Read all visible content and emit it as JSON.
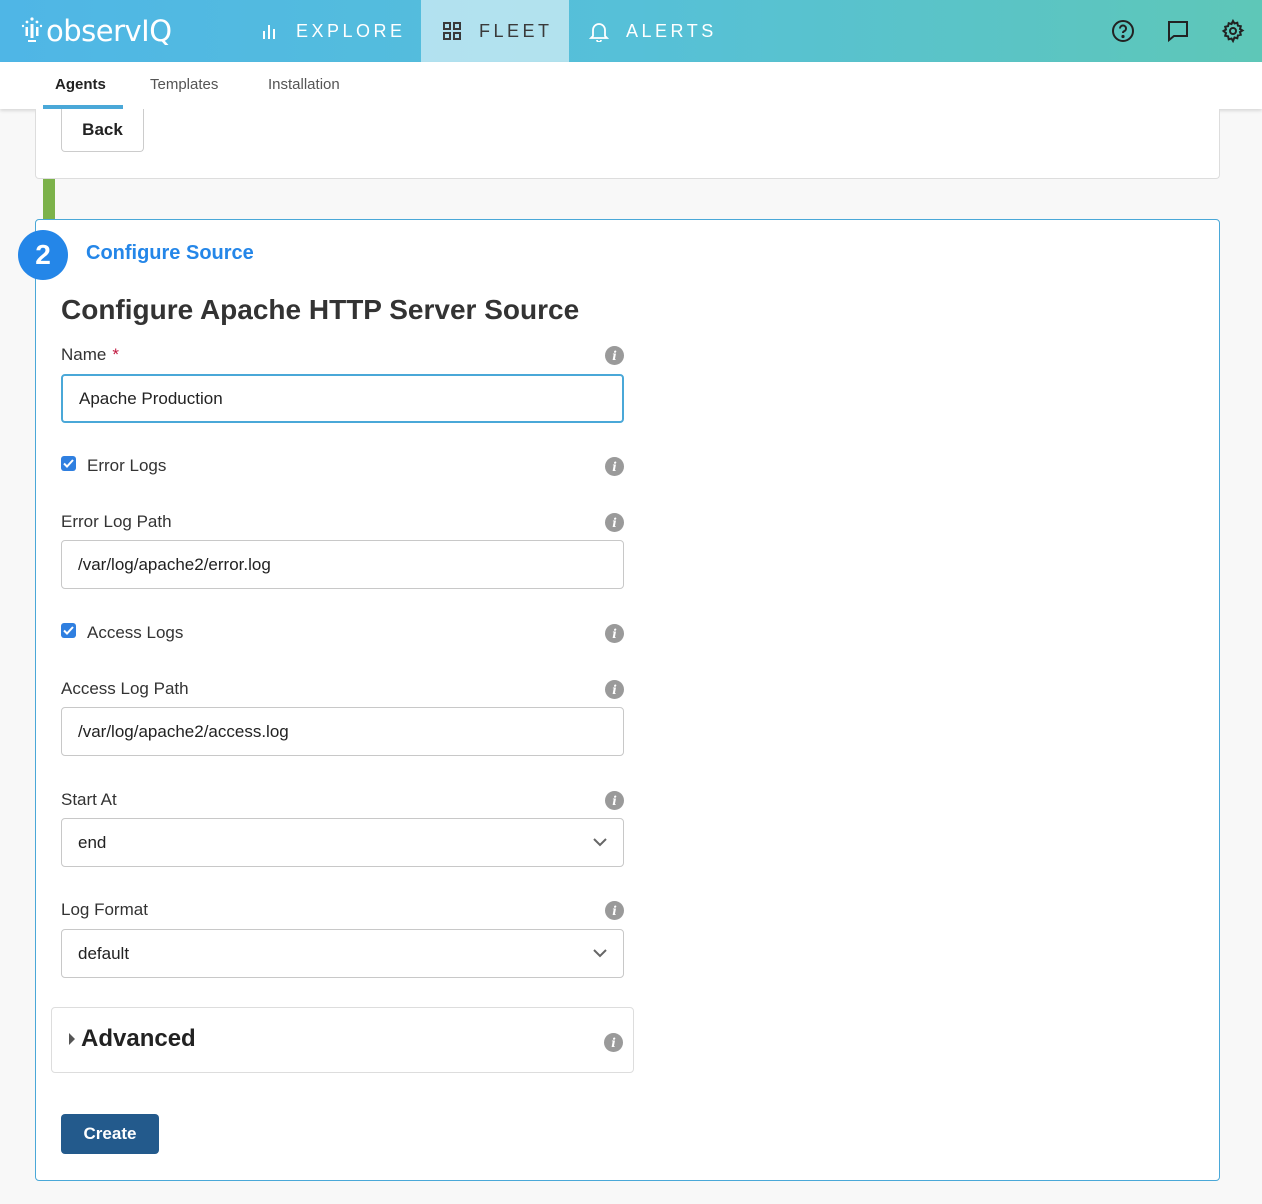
{
  "app": {
    "logo_text": "observIQ"
  },
  "nav": {
    "explore": "EXPLORE",
    "fleet": "FLEET",
    "alerts": "ALERTS"
  },
  "toolbar": {
    "help_icon": "help-circle-icon",
    "feedback_icon": "chat-icon",
    "settings_icon": "gear-icon"
  },
  "subnav": {
    "tabs": [
      "Agents",
      "Templates",
      "Installation"
    ],
    "active": "Agents"
  },
  "back_label": "Back",
  "step": {
    "number": "2",
    "label": "Configure Source"
  },
  "form": {
    "title": "Configure Apache HTTP Server Source",
    "name": {
      "label": "Name",
      "required_mark": "*",
      "value": "Apache Production"
    },
    "error_logs": {
      "label": "Error Logs",
      "checked": true
    },
    "error_log_path": {
      "label": "Error Log Path",
      "value": "/var/log/apache2/error.log"
    },
    "access_logs": {
      "label": "Access Logs",
      "checked": true
    },
    "access_log_path": {
      "label": "Access Log Path",
      "value": "/var/log/apache2/access.log"
    },
    "start_at": {
      "label": "Start At",
      "value": "end"
    },
    "log_format": {
      "label": "Log Format",
      "value": "default"
    },
    "advanced": {
      "label": "Advanced"
    },
    "create_label": "Create"
  },
  "colors": {
    "accent": "#2486e8",
    "primary_button": "#235a8c",
    "stepper_done": "#7cb24a"
  }
}
